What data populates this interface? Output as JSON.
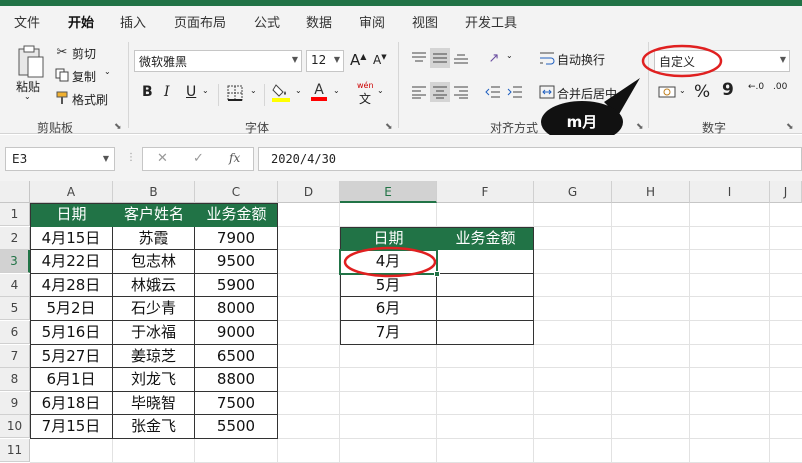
{
  "menu": {
    "tabs": [
      "文件",
      "开始",
      "插入",
      "页面布局",
      "公式",
      "数据",
      "审阅",
      "视图",
      "开发工具"
    ]
  },
  "ribbon": {
    "clipboard": {
      "paste": "粘贴",
      "cut": "剪切",
      "copy": "复制",
      "format_painter": "格式刷",
      "label": "剪贴板"
    },
    "font": {
      "name": "微软雅黑",
      "size": "12",
      "grow": "A",
      "shrink": "A",
      "bold": "B",
      "italic": "I",
      "underline": "U",
      "phonetic_top": "wén",
      "phonetic_bottom": "文",
      "label": "字体"
    },
    "alignment": {
      "wrap": "自动换行",
      "merge": "合并后居中",
      "label": "对齐方式"
    },
    "number": {
      "format": "自定义",
      "percent": "%",
      "comma": "9",
      "inc_decimals": "←.0",
      "dec_decimals": ".00",
      "label": "数字"
    }
  },
  "formula_bar": {
    "name_box": "E3",
    "formula": "2020/4/30",
    "fx": "fx",
    "cancel": "✕",
    "enter": "✓"
  },
  "grid": {
    "columns": [
      "A",
      "B",
      "C",
      "D",
      "E",
      "F",
      "G",
      "H",
      "I",
      "J"
    ],
    "rows": [
      "1",
      "2",
      "3",
      "4",
      "5",
      "6",
      "7",
      "8",
      "9",
      "10",
      "11"
    ],
    "table1": {
      "headers": [
        "日期",
        "客户姓名",
        "业务金额"
      ],
      "rows": [
        [
          "4月15日",
          "苏霞",
          "7900"
        ],
        [
          "4月22日",
          "包志林",
          "9500"
        ],
        [
          "4月28日",
          "林娥云",
          "5900"
        ],
        [
          "5月2日",
          "石少青",
          "8000"
        ],
        [
          "5月16日",
          "于冰福",
          "9000"
        ],
        [
          "5月27日",
          "姜琼芝",
          "6500"
        ],
        [
          "6月1日",
          "刘龙飞",
          "8800"
        ],
        [
          "6月18日",
          "毕晓智",
          "7500"
        ],
        [
          "7月15日",
          "张金飞",
          "5500"
        ]
      ]
    },
    "table2": {
      "headers": [
        "日期",
        "业务金额"
      ],
      "rows": [
        [
          "4月",
          ""
        ],
        [
          "5月",
          ""
        ],
        [
          "6月",
          ""
        ],
        [
          "7月",
          ""
        ]
      ]
    }
  },
  "callout": {
    "text": "m月"
  },
  "colors": {
    "accent": "#217346",
    "highlight_ring": "#e02020"
  }
}
